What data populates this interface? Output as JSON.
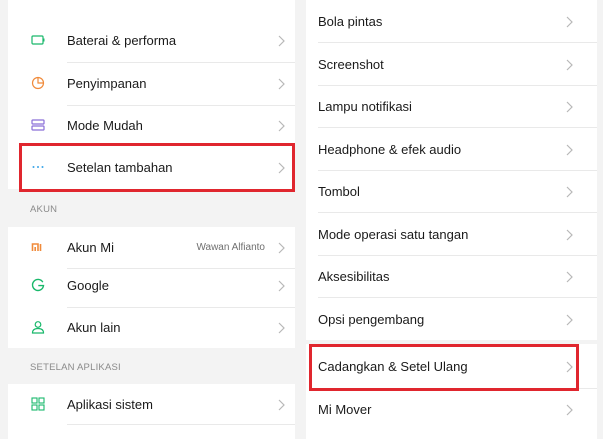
{
  "left": {
    "rows_top": [
      {
        "label": "Baterai & performa",
        "icon": "battery-icon"
      },
      {
        "label": "Penyimpanan",
        "icon": "storage-pie-icon"
      },
      {
        "label": "Mode Mudah",
        "icon": "easy-mode-icon"
      },
      {
        "label": "Setelan tambahan",
        "icon": "more-dots-icon"
      }
    ],
    "section_akun": "AKUN",
    "rows_akun": [
      {
        "label": "Akun Mi",
        "value": "Wawan Alfianto",
        "icon": "mi-logo-icon"
      },
      {
        "label": "Google",
        "icon": "google-g-icon"
      },
      {
        "label": "Akun lain",
        "icon": "person-icon"
      }
    ],
    "section_aplikasi": "SETELAN APLIKASI",
    "rows_aplikasi": [
      {
        "label": "Aplikasi sistem",
        "icon": "apps-grid-icon"
      }
    ]
  },
  "right": {
    "rows": [
      {
        "label": "Bola pintas"
      },
      {
        "label": "Screenshot"
      },
      {
        "label": "Lampu notifikasi"
      },
      {
        "label": "Headphone & efek audio"
      },
      {
        "label": "Tombol"
      },
      {
        "label": "Mode operasi satu tangan"
      },
      {
        "label": "Aksesibilitas"
      },
      {
        "label": "Opsi pengembang"
      },
      {
        "label": "Cadangkan & Setel Ulang"
      },
      {
        "label": "Mi Mover"
      }
    ]
  },
  "colors": {
    "highlight": "#e0262e",
    "icon_green": "#19b86b",
    "icon_orange": "#f08a3a",
    "icon_purple": "#8a6fd8",
    "icon_blue": "#3aa5e8",
    "chevron": "#b8b8b8"
  }
}
